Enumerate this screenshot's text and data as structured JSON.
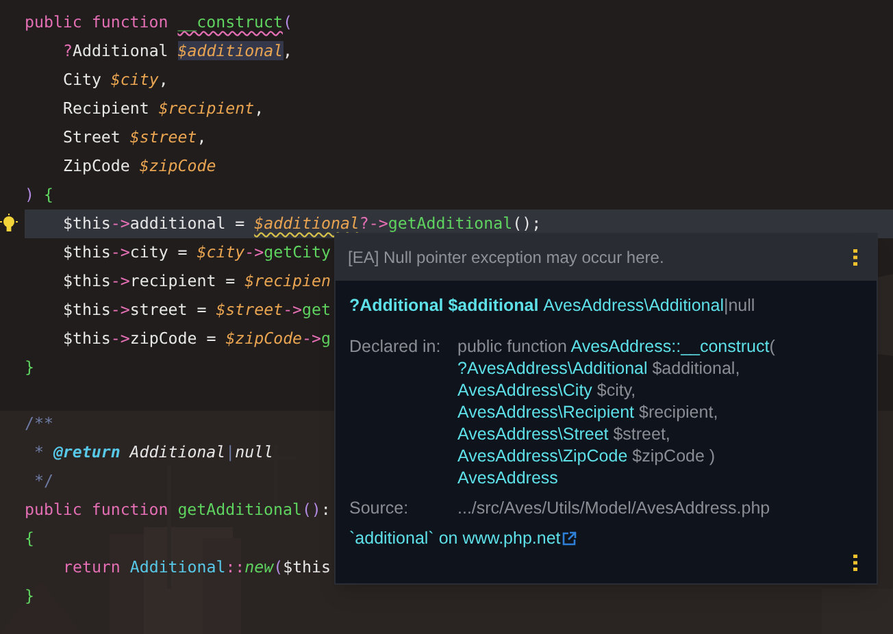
{
  "editor": {
    "lines": [
      {
        "tokens": [
          {
            "text": "public ",
            "kind": "kw"
          },
          {
            "text": "function ",
            "kind": "kw"
          },
          {
            "text": "__construct",
            "kind": "fn",
            "error": true
          },
          {
            "text": "(",
            "kind": "paren"
          }
        ]
      },
      {
        "indent": true,
        "tokens": [
          {
            "text": "?",
            "kind": "op"
          },
          {
            "text": "Additional ",
            "kind": "type"
          },
          {
            "text": "$additional",
            "kind": "var",
            "highlight": true
          },
          {
            "text": ",",
            "kind": "type"
          }
        ]
      },
      {
        "indent": true,
        "tokens": [
          {
            "text": "City ",
            "kind": "type"
          },
          {
            "text": "$city",
            "kind": "var"
          },
          {
            "text": ",",
            "kind": "type"
          }
        ]
      },
      {
        "indent": true,
        "tokens": [
          {
            "text": "Recipient ",
            "kind": "type"
          },
          {
            "text": "$recipient",
            "kind": "var"
          },
          {
            "text": ",",
            "kind": "type"
          }
        ]
      },
      {
        "indent": true,
        "tokens": [
          {
            "text": "Street ",
            "kind": "type"
          },
          {
            "text": "$street",
            "kind": "var"
          },
          {
            "text": ",",
            "kind": "type"
          }
        ]
      },
      {
        "indent": true,
        "tokens": [
          {
            "text": "ZipCode ",
            "kind": "type"
          },
          {
            "text": "$zipCode",
            "kind": "var"
          }
        ]
      },
      {
        "tokens": [
          {
            "text": ") ",
            "kind": "paren"
          },
          {
            "text": "{",
            "kind": "brace"
          }
        ]
      },
      {
        "indent": true,
        "current": true,
        "hint": true,
        "tokens": [
          {
            "text": "$this",
            "kind": "type"
          },
          {
            "text": "->",
            "kind": "op"
          },
          {
            "text": "additional = ",
            "kind": "type"
          },
          {
            "text": "$additional",
            "kind": "var",
            "warning": true
          },
          {
            "text": "?->",
            "kind": "op"
          },
          {
            "text": "getAdditional",
            "kind": "fn"
          },
          {
            "text": "();",
            "kind": "type"
          }
        ]
      },
      {
        "indent": true,
        "tokens": [
          {
            "text": "$this",
            "kind": "type"
          },
          {
            "text": "->",
            "kind": "op"
          },
          {
            "text": "city = ",
            "kind": "type"
          },
          {
            "text": "$city",
            "kind": "var"
          },
          {
            "text": "->",
            "kind": "op"
          },
          {
            "text": "getCity",
            "kind": "fn"
          }
        ]
      },
      {
        "indent": true,
        "tokens": [
          {
            "text": "$this",
            "kind": "type"
          },
          {
            "text": "->",
            "kind": "op"
          },
          {
            "text": "recipient = ",
            "kind": "type"
          },
          {
            "text": "$recipien",
            "kind": "var"
          }
        ]
      },
      {
        "indent": true,
        "tokens": [
          {
            "text": "$this",
            "kind": "type"
          },
          {
            "text": "->",
            "kind": "op"
          },
          {
            "text": "street = ",
            "kind": "type"
          },
          {
            "text": "$street",
            "kind": "var"
          },
          {
            "text": "->",
            "kind": "op"
          },
          {
            "text": "get",
            "kind": "fn"
          }
        ]
      },
      {
        "indent": true,
        "tokens": [
          {
            "text": "$this",
            "kind": "type"
          },
          {
            "text": "->",
            "kind": "op"
          },
          {
            "text": "zipCode = ",
            "kind": "type"
          },
          {
            "text": "$zipCode",
            "kind": "var"
          },
          {
            "text": "->",
            "kind": "op"
          },
          {
            "text": "g",
            "kind": "fn"
          }
        ]
      },
      {
        "tokens": [
          {
            "text": "}",
            "kind": "brace"
          }
        ]
      },
      {
        "blank_before": true,
        "tokens": [
          {
            "text": "/**",
            "kind": "comment"
          }
        ]
      },
      {
        "tokens": [
          {
            "text": " * ",
            "kind": "comment"
          },
          {
            "text": "@return",
            "kind": "doctag"
          },
          {
            "text": " Additional",
            "kind": "doctype"
          },
          {
            "text": "|",
            "kind": "comment"
          },
          {
            "text": "null",
            "kind": "doctype"
          }
        ]
      },
      {
        "tokens": [
          {
            "text": " */",
            "kind": "comment"
          }
        ]
      },
      {
        "tokens": [
          {
            "text": "public ",
            "kind": "kw"
          },
          {
            "text": "function ",
            "kind": "kw"
          },
          {
            "text": "getAdditional",
            "kind": "fn"
          },
          {
            "text": "()",
            "kind": "paren"
          },
          {
            "text": ":",
            "kind": "type"
          }
        ]
      },
      {
        "tokens": [
          {
            "text": "{",
            "kind": "brace"
          }
        ]
      },
      {
        "indent": true,
        "tokens": [
          {
            "text": "return ",
            "kind": "kw"
          },
          {
            "text": "Additional",
            "kind": "class"
          },
          {
            "text": "::",
            "kind": "op"
          },
          {
            "text": "new",
            "kind": "static"
          },
          {
            "text": "(",
            "kind": "paren"
          },
          {
            "text": "$this",
            "kind": "type"
          }
        ]
      },
      {
        "tokens": [
          {
            "text": "}",
            "kind": "brace"
          }
        ]
      }
    ]
  },
  "popup": {
    "message": "[EA] Null pointer exception may occur here.",
    "signature": [
      {
        "text": "?Additional $additional ",
        "kind": "strong"
      },
      {
        "text": "AvesAddress\\Additional",
        "kind": "type"
      },
      {
        "text": "|null",
        "kind": "plain"
      }
    ],
    "declared_label": "Declared in:",
    "declared_lines": [
      [
        {
          "text": "public function ",
          "kind": "plain"
        },
        {
          "text": "AvesAddress::__construct",
          "kind": "type"
        },
        {
          "text": "(",
          "kind": "plain"
        }
      ],
      [
        {
          "text": "?AvesAddress\\Additional",
          "kind": "type"
        },
        {
          "text": " $additional,",
          "kind": "plain"
        }
      ],
      [
        {
          "text": "AvesAddress\\City",
          "kind": "type"
        },
        {
          "text": " $city,",
          "kind": "plain"
        }
      ],
      [
        {
          "text": "AvesAddress\\Recipient",
          "kind": "type"
        },
        {
          "text": " $recipient,",
          "kind": "plain"
        }
      ],
      [
        {
          "text": "AvesAddress\\Street",
          "kind": "type"
        },
        {
          "text": " $street,",
          "kind": "plain"
        }
      ],
      [
        {
          "text": "AvesAddress\\ZipCode",
          "kind": "type"
        },
        {
          "text": " $zipCode )",
          "kind": "plain"
        }
      ],
      [
        {
          "text": "AvesAddress",
          "kind": "type"
        }
      ]
    ],
    "source_label": "Source:",
    "source": ".../src/Aves/Utils/Model/AvesAddress.php",
    "link": "`additional` on www.php.net"
  }
}
